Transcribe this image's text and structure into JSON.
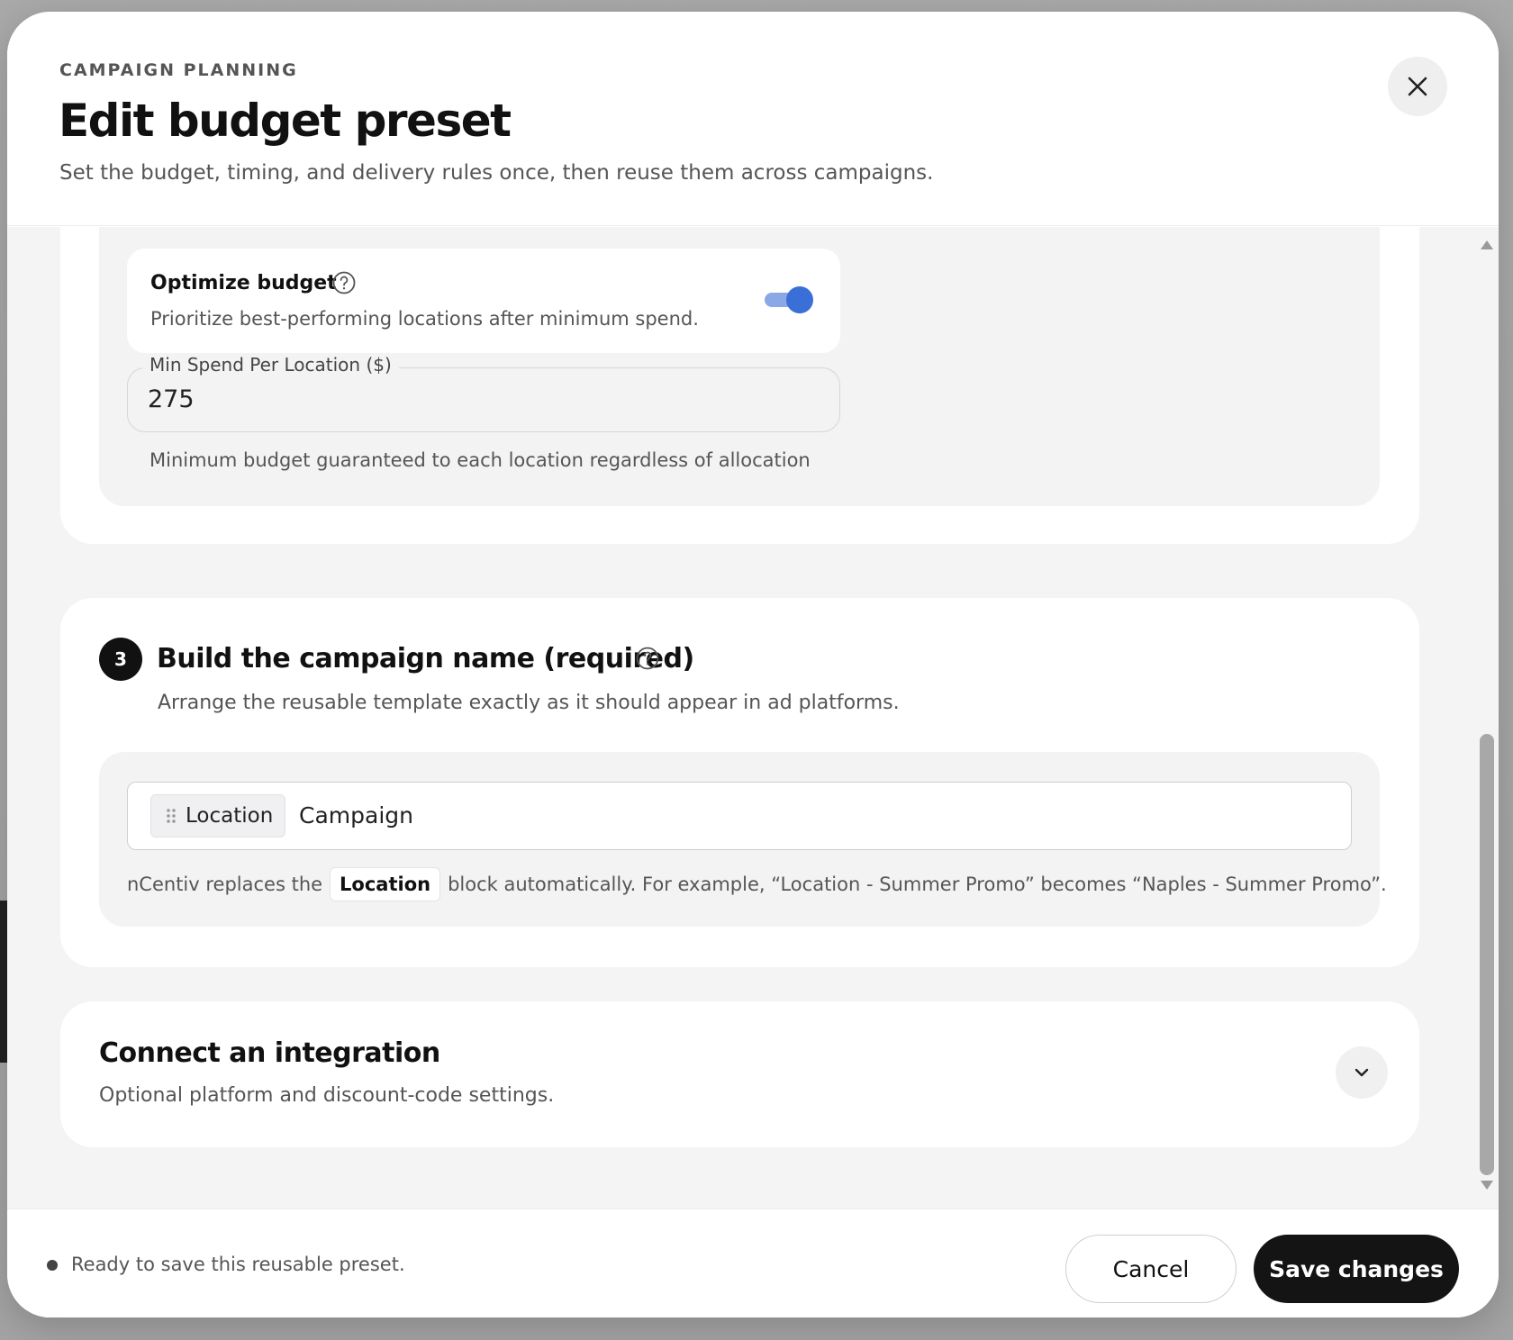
{
  "header": {
    "eyebrow": "CAMPAIGN PLANNING",
    "title": "Edit budget preset",
    "subtitle": "Set the budget, timing, and delivery rules once, then reuse them across campaigns."
  },
  "budget_section": {
    "optimize": {
      "title": "Optimize budget",
      "description": "Prioritize best-performing locations after minimum spend.",
      "enabled": true
    },
    "min_spend": {
      "label": "Min Spend Per Location ($)",
      "value": "275",
      "help": "Minimum budget guaranteed to each location regardless of allocation"
    }
  },
  "name_section": {
    "step": "3",
    "title": "Build the campaign name (required)",
    "description": "Arrange the reusable template exactly as it should appear in ad platforms.",
    "chip_label": "Location",
    "template_text": "Campaign",
    "help_before": "nCentiv replaces the",
    "help_chip": "Location",
    "help_after": "block automatically. For example,  “Location - Summer Promo” becomes “Naples - Summer Promo”."
  },
  "integration_section": {
    "title": "Connect an integration",
    "description": "Optional platform and discount-code settings."
  },
  "footer": {
    "status": "Ready to save this reusable preset.",
    "cancel_label": "Cancel",
    "save_label": "Save changes"
  },
  "colors": {
    "accent": "#3a6fd8",
    "primary_button": "#141414"
  },
  "icons": [
    "close-icon",
    "help-icon",
    "drag-handle-icon",
    "chevron-down-icon"
  ]
}
